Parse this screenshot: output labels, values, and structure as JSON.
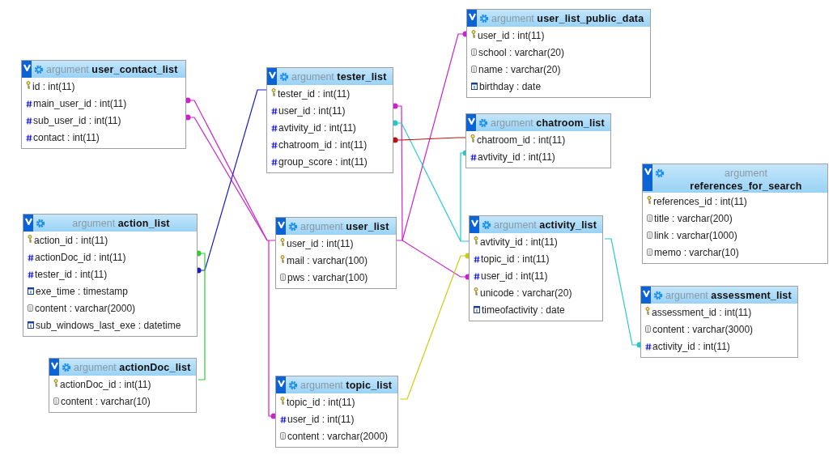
{
  "tables": [
    {
      "schema": "argument",
      "name": "user_contact_list",
      "columns": [
        {
          "kind": "key",
          "text": "id : int(11)"
        },
        {
          "kind": "index",
          "text": "main_user_id : int(11)"
        },
        {
          "kind": "index",
          "text": "sub_user_id : int(11)"
        },
        {
          "kind": "index",
          "text": "contact : int(11)"
        }
      ]
    },
    {
      "schema": "argument",
      "name": "tester_list",
      "columns": [
        {
          "kind": "key",
          "text": "tester_id : int(11)"
        },
        {
          "kind": "index",
          "text": "user_id : int(11)"
        },
        {
          "kind": "index",
          "text": "avtivity_id : int(11)"
        },
        {
          "kind": "index",
          "text": "chatroom_id : int(11)"
        },
        {
          "kind": "index",
          "text": "group_score : int(11)"
        }
      ]
    },
    {
      "schema": "argument",
      "name": "user_list_public_data",
      "columns": [
        {
          "kind": "key",
          "text": "user_id : int(11)"
        },
        {
          "kind": "text",
          "text": "school : varchar(20)"
        },
        {
          "kind": "text",
          "text": "name : varchar(20)"
        },
        {
          "kind": "date",
          "text": "birthday : date"
        }
      ]
    },
    {
      "schema": "argument",
      "name": "chatroom_list",
      "columns": [
        {
          "kind": "key",
          "text": "chatroom_id : int(11)"
        },
        {
          "kind": "index",
          "text": "avtivity_id : int(11)"
        }
      ]
    },
    {
      "schema": "argument",
      "name": "references_for_search",
      "columns": [
        {
          "kind": "key",
          "text": "references_id : int(11)"
        },
        {
          "kind": "text",
          "text": "title : varchar(200)"
        },
        {
          "kind": "text",
          "text": "link : varchar(1000)"
        },
        {
          "kind": "text",
          "text": "memo : varchar(10)"
        }
      ]
    },
    {
      "schema": "argument",
      "name": "action_list",
      "columns": [
        {
          "kind": "key",
          "text": "action_id : int(11)"
        },
        {
          "kind": "index",
          "text": "actionDoc_id : int(11)"
        },
        {
          "kind": "index",
          "text": "tester_id : int(11)"
        },
        {
          "kind": "date",
          "text": "exe_time : timestamp"
        },
        {
          "kind": "text",
          "text": "content : varchar(2000)"
        },
        {
          "kind": "date",
          "text": "sub_windows_last_exe : datetime"
        }
      ]
    },
    {
      "schema": "argument",
      "name": "user_list",
      "columns": [
        {
          "kind": "key",
          "text": "user_id : int(11)"
        },
        {
          "kind": "key",
          "text": "mail : varchar(100)"
        },
        {
          "kind": "text",
          "text": "pws : varchar(100)"
        }
      ]
    },
    {
      "schema": "argument",
      "name": "activity_list",
      "columns": [
        {
          "kind": "key",
          "text": "avtivity_id : int(11)"
        },
        {
          "kind": "index",
          "text": "topic_id : int(11)"
        },
        {
          "kind": "index",
          "text": "user_id : int(11)"
        },
        {
          "kind": "key",
          "text": "unicode : varchar(20)"
        },
        {
          "kind": "date",
          "text": "timeofactivity : date"
        }
      ]
    },
    {
      "schema": "argument",
      "name": "assessment_list",
      "columns": [
        {
          "kind": "key",
          "text": "assessment_id : int(11)"
        },
        {
          "kind": "text",
          "text": "content : varchar(3000)"
        },
        {
          "kind": "index",
          "text": "activity_id : int(11)"
        }
      ]
    },
    {
      "schema": "argument",
      "name": "actionDoc_list",
      "columns": [
        {
          "kind": "key",
          "text": "actionDoc_id : int(11)"
        },
        {
          "kind": "text",
          "text": "content : varchar(10)"
        }
      ]
    },
    {
      "schema": "argument",
      "name": "topic_list",
      "columns": [
        {
          "kind": "key",
          "text": "topic_id : int(11)"
        },
        {
          "kind": "index",
          "text": "user_id : int(11)"
        },
        {
          "kind": "text",
          "text": "content : varchar(2000)"
        }
      ]
    }
  ]
}
